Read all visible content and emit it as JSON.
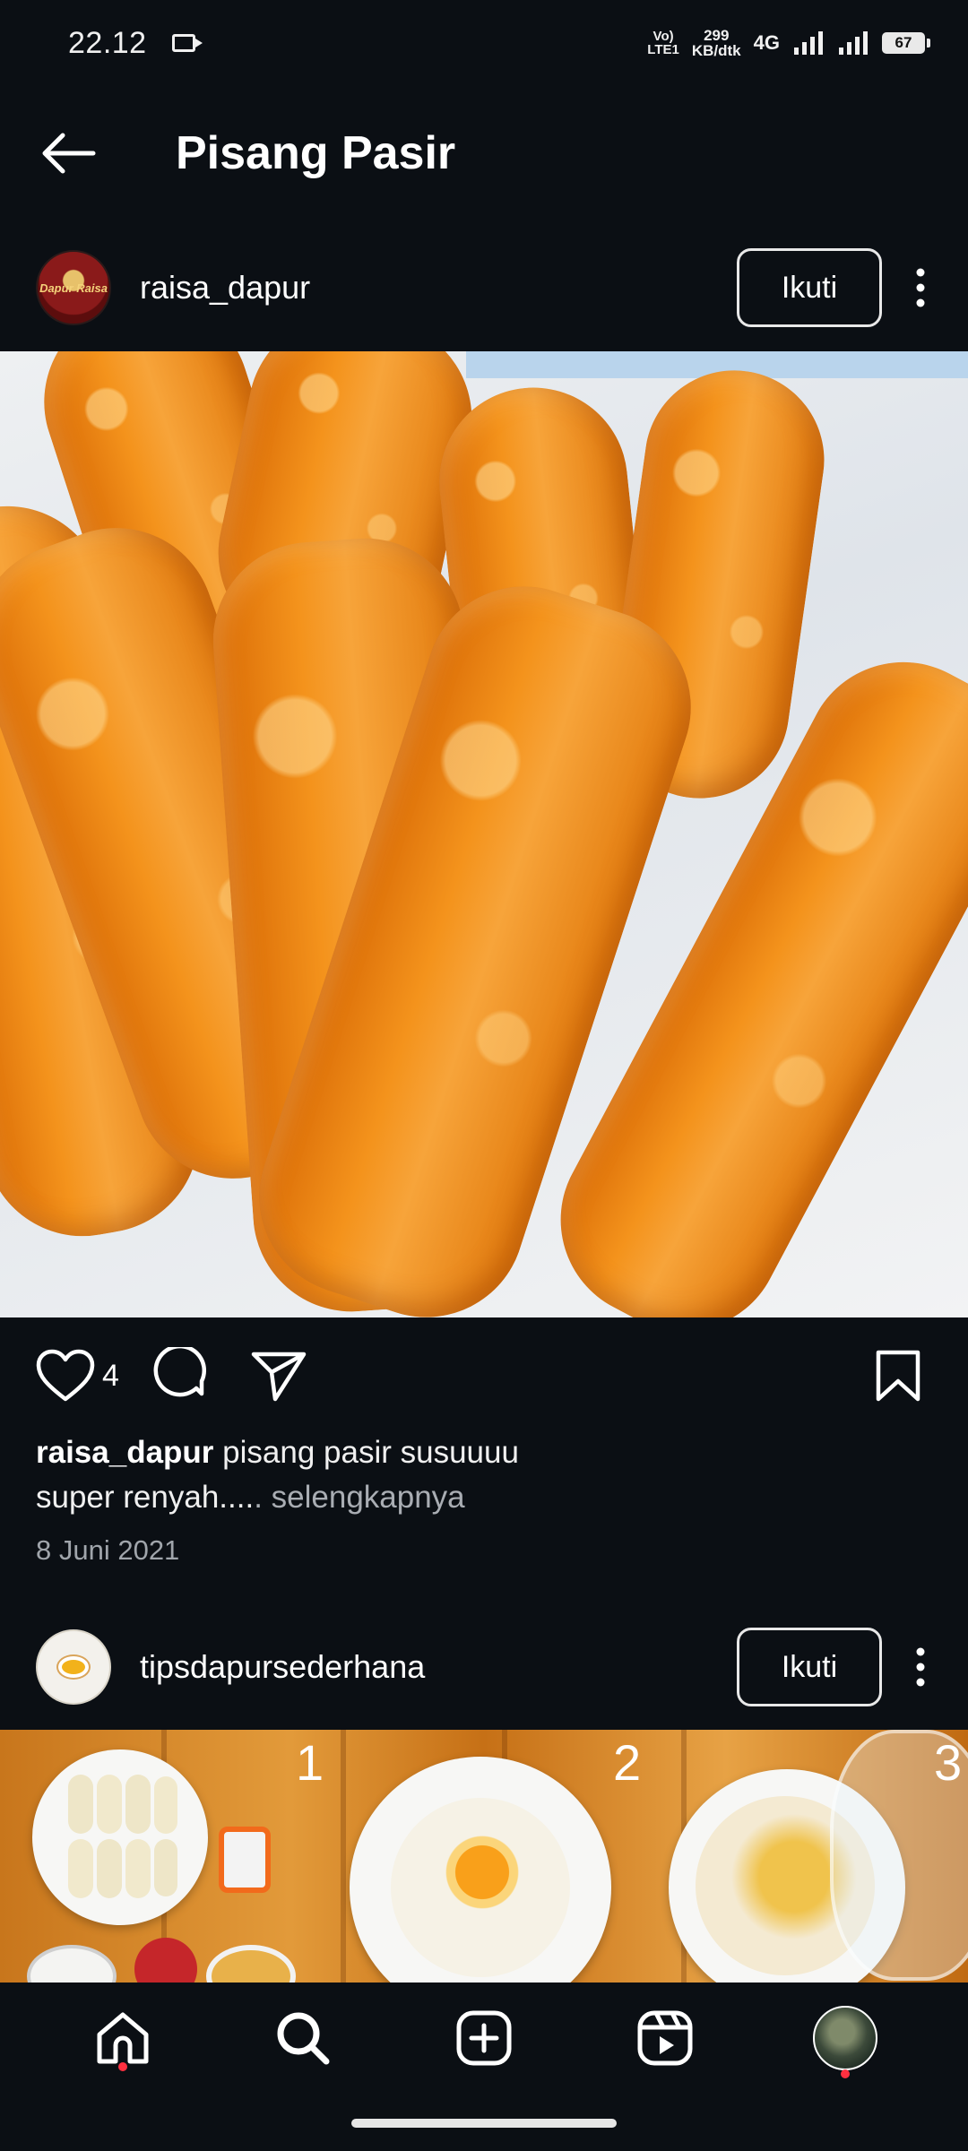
{
  "status_bar": {
    "time": "22.12",
    "volte_line1": "Vo)",
    "volte_line2": "LTE1",
    "speed_value": "299",
    "speed_unit": "KB/dtk",
    "network": "4G",
    "battery": "67"
  },
  "header": {
    "title": "Pisang Pasir",
    "back_icon": "arrow-left-icon"
  },
  "posts": [
    {
      "username": "raisa_dapur",
      "avatar_text": "Dapur Raisa",
      "follow_label": "Ikuti",
      "likes": "4",
      "caption_user": "raisa_dapur",
      "caption_line1": " pisang pasir susuuuu",
      "caption_line2": "super renyah....",
      "caption_more": ". selengkapnya",
      "date": "8 Juni 2021"
    },
    {
      "username": "tipsdapursederhana",
      "follow_label": "Ikuti",
      "step_numbers": [
        "1",
        "2",
        "3"
      ]
    }
  ],
  "bottom_nav": {
    "items": [
      "home-icon",
      "search-icon",
      "create-post-icon",
      "reels-icon",
      "profile-avatar"
    ]
  },
  "colors": {
    "background": "#0b0f14",
    "notification_dot": "#ff3040",
    "secondary_text": "#a0a5ab"
  }
}
